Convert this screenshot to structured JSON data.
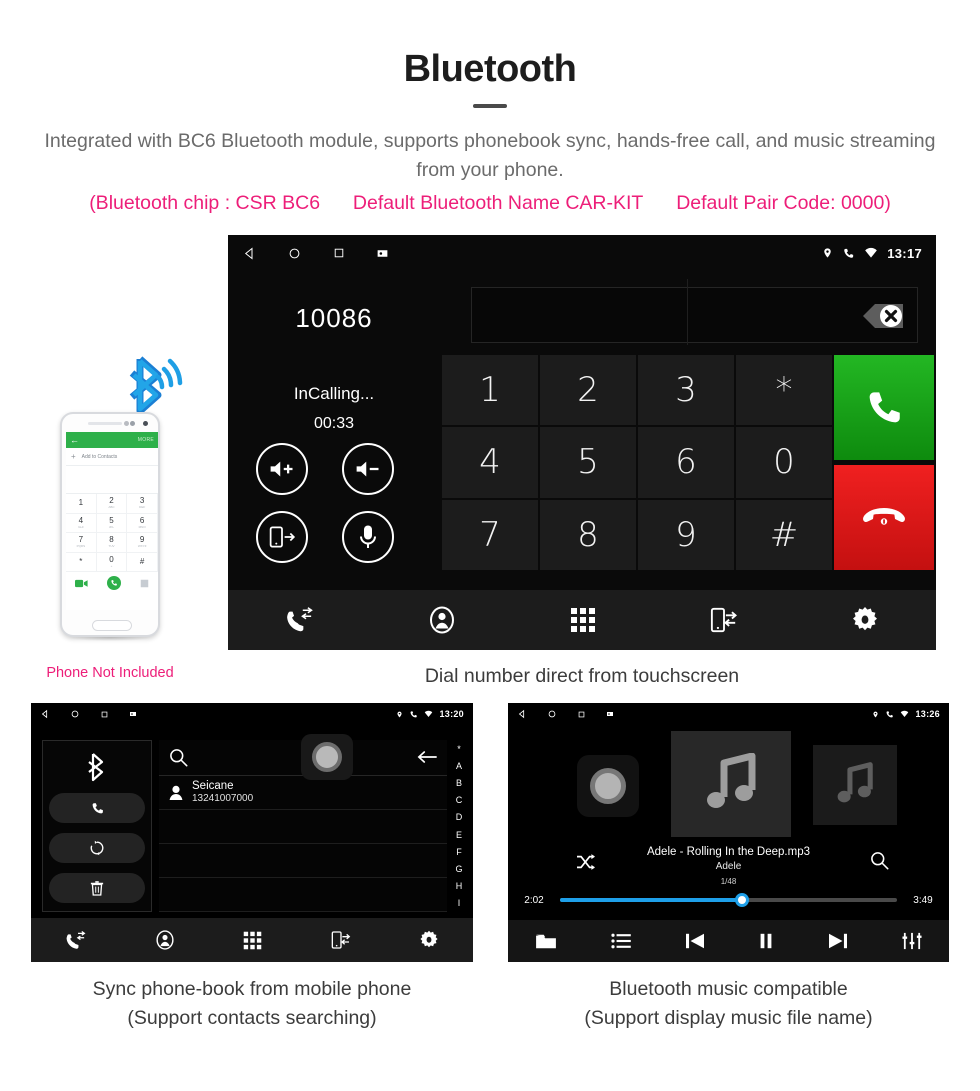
{
  "header": {
    "title": "Bluetooth",
    "subtitle": "Integrated with BC6 Bluetooth module, supports phonebook sync, hands-free call, and music streaming from your phone.",
    "spec_open": "(Bluetooth chip : CSR BC6",
    "spec_name": "Default Bluetooth Name CAR-KIT",
    "spec_pair": "Default Pair Code: 0000)",
    "accent_color": "#ED1E79",
    "text_color": "#6b6b6b"
  },
  "main_screen": {
    "statusbar": {
      "time": "13:17"
    },
    "dialed_number": "10086",
    "call_status": "InCalling...",
    "call_timer": "00:33",
    "call_actions": [
      {
        "name": "volume-up-button",
        "icon": "speaker-plus-icon"
      },
      {
        "name": "volume-down-button",
        "icon": "speaker-minus-icon"
      },
      {
        "name": "transfer-to-phone-button",
        "icon": "phone-transfer-icon"
      },
      {
        "name": "mute-microphone-button",
        "icon": "microphone-icon"
      }
    ],
    "input_value": "",
    "keys": [
      "1",
      "2",
      "3",
      "*",
      "4",
      "5",
      "6",
      "0",
      "7",
      "8",
      "9",
      "#"
    ],
    "call_button_color": "#16a016",
    "hangup_button_color": "#e01717",
    "bottom_nav": [
      {
        "name": "call-log-tab",
        "icon": "call-log-icon"
      },
      {
        "name": "contacts-tab",
        "icon": "contact-avatar-icon"
      },
      {
        "name": "keypad-tab",
        "icon": "keypad-grid-icon"
      },
      {
        "name": "phone-sync-tab",
        "icon": "phone-sync-icon"
      },
      {
        "name": "settings-tab",
        "icon": "gear-icon"
      }
    ],
    "caption": "Dial number direct from touchscreen"
  },
  "phone_mock": {
    "topbar_back": "←",
    "topbar_more": "MORE",
    "add_contact_label": "Add to Contacts",
    "keys": [
      {
        "digit": "1",
        "letters": ""
      },
      {
        "digit": "2",
        "letters": "ABC"
      },
      {
        "digit": "3",
        "letters": "DEF"
      },
      {
        "digit": "4",
        "letters": "GHI"
      },
      {
        "digit": "5",
        "letters": "JKL"
      },
      {
        "digit": "6",
        "letters": "MNO"
      },
      {
        "digit": "7",
        "letters": "PQRS"
      },
      {
        "digit": "8",
        "letters": "TUV"
      },
      {
        "digit": "9",
        "letters": "WXYZ"
      },
      {
        "digit": "*",
        "letters": ""
      },
      {
        "digit": "0",
        "letters": "+"
      },
      {
        "digit": "#",
        "letters": ""
      }
    ],
    "caption": "Phone Not Included"
  },
  "phonebook_screen": {
    "statusbar": {
      "time": "13:20"
    },
    "side_actions": [
      {
        "name": "bluetooth-status-icon",
        "icon": "bluetooth-icon"
      },
      {
        "name": "call-button",
        "icon": "phone-icon"
      },
      {
        "name": "sync-contacts-button",
        "icon": "sync-icon"
      },
      {
        "name": "delete-contacts-button",
        "icon": "trash-icon"
      }
    ],
    "search_placeholder": "",
    "contacts": [
      {
        "name": "Seicane",
        "number": "13241007000"
      }
    ],
    "alpha_index": [
      "*",
      "A",
      "B",
      "C",
      "D",
      "E",
      "F",
      "G",
      "H",
      "I"
    ],
    "bottom_nav": [
      {
        "name": "call-log-tab",
        "icon": "call-log-icon"
      },
      {
        "name": "contacts-tab",
        "icon": "contact-avatar-icon"
      },
      {
        "name": "keypad-tab",
        "icon": "keypad-grid-icon"
      },
      {
        "name": "phone-sync-tab",
        "icon": "phone-sync-icon"
      },
      {
        "name": "settings-tab",
        "icon": "gear-icon"
      }
    ],
    "caption_line1": "Sync phone-book from mobile phone",
    "caption_line2": "(Support contacts searching)"
  },
  "music_screen": {
    "statusbar": {
      "time": "13:26"
    },
    "track_title": "Adele - Rolling In the Deep.mp3",
    "artist": "Adele",
    "track_index": "1/48",
    "elapsed": "2:02",
    "duration": "3:49",
    "progress_percent": 54,
    "progress_color": "#1e9fe8",
    "transport": [
      {
        "name": "browse-folder-button",
        "icon": "folder-icon"
      },
      {
        "name": "playlist-button",
        "icon": "list-icon"
      },
      {
        "name": "previous-track-button",
        "icon": "previous-icon"
      },
      {
        "name": "pause-button",
        "icon": "pause-icon"
      },
      {
        "name": "next-track-button",
        "icon": "next-icon"
      },
      {
        "name": "equalizer-button",
        "icon": "equalizer-icon"
      }
    ],
    "caption_line1": "Bluetooth music compatible",
    "caption_line2": "(Support display music file name)"
  }
}
